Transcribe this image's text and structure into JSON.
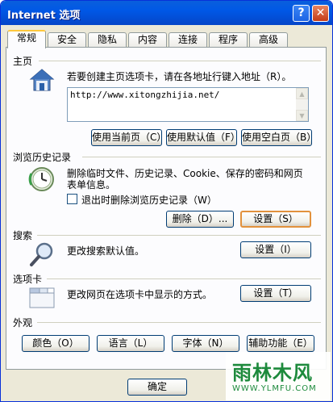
{
  "window": {
    "title": "Internet 选项",
    "help_label": "?",
    "close_label": "✕"
  },
  "tabs": [
    {
      "label": "常规"
    },
    {
      "label": "安全"
    },
    {
      "label": "隐私"
    },
    {
      "label": "内容"
    },
    {
      "label": "连接"
    },
    {
      "label": "程序"
    },
    {
      "label": "高级"
    }
  ],
  "homepage": {
    "section_label": "主页",
    "description": "若要创建主页选项卡，请在各地址行键入地址（R）。",
    "url_value": "http://www.xitongzhijia.net/",
    "use_current": "使用当前页（C）",
    "use_default": "使用默认值（F）",
    "use_blank": "使用空白页（B）"
  },
  "history": {
    "section_label": "浏览历史记录",
    "description_line1": "删除临时文件、历史记录、Cookie、保存的密码和网页",
    "description_line2": "表单信息。",
    "checkbox_label": "退出时删除浏览历史记录（W）",
    "checkbox_checked": false,
    "delete_button": "删除（D）...",
    "settings_button": "设置（S）"
  },
  "search": {
    "section_label": "搜索",
    "description": "更改搜索默认值。",
    "settings_button": "设置（I）"
  },
  "tabs_section": {
    "section_label": "选项卡",
    "description": "更改网页在选项卡中显示的方式。",
    "settings_button": "设置（T）"
  },
  "appearance": {
    "section_label": "外观",
    "colors": "颜色（O）",
    "languages": "语言（L）",
    "fonts": "字体（N）",
    "accessibility": "辅助功能（E）"
  },
  "footer": {
    "ok": "确定"
  },
  "watermark": {
    "line1": "雨林木风",
    "line2": "WWW.YLMFU.COM"
  },
  "icons": {
    "home": "house-icon",
    "history": "clock-icon",
    "search": "magnifier-icon",
    "tabs": "tabbed-window-icon"
  }
}
